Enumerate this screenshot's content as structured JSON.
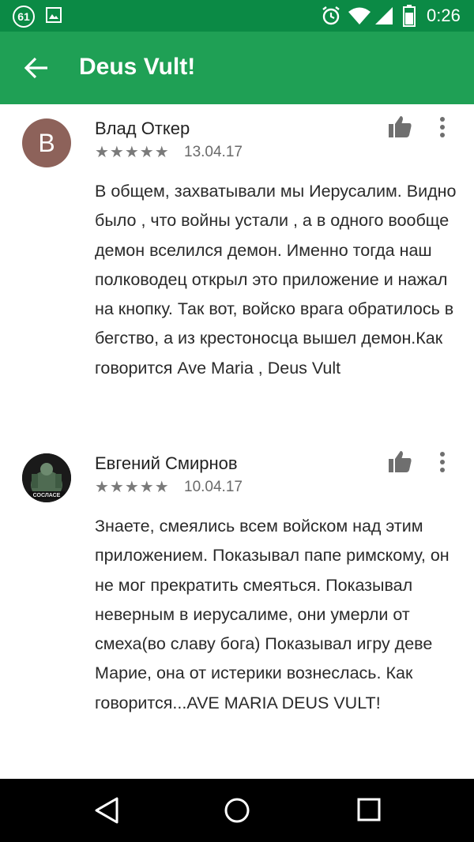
{
  "status_bar": {
    "notification_count": "61",
    "time": "0:26",
    "icons": [
      "image-icon",
      "alarm-icon",
      "wifi-icon",
      "signal-icon",
      "battery-icon"
    ]
  },
  "app_bar": {
    "title": "Deus Vult!",
    "background": "#1fa055",
    "status_background": "#0b8a45"
  },
  "reviews": [
    {
      "avatar_letter": "B",
      "author": "Влад Откер",
      "stars": "★★★★★",
      "rating": 5,
      "date": "13.04.17",
      "text": "В общем, захватывали мы Иерусалим. Видно было , что войны устали , а в одного вообще демон вселился демон. Именно тогда наш полководец открыл это приложение и нажал на кнопку. Так вот, войско врага обратилось в бегство, а из крестоносца вышел демон.Как говорится Ave Maria , Deus Vult"
    },
    {
      "avatar_caption": "СОСЛАСЕ",
      "author": "Евгений Смирнов",
      "stars": "★★★★★",
      "rating": 5,
      "date": "10.04.17",
      "text": "Знаете, смеялись всем войском над этим приложением. Показывал папе римскому, он не мог прекратить смеяться. Показывал неверным в иерусалиме, они умерли от смеха(во славу бога) Показывал игру деве Марие, она от истерики вознеслась. Как говорится...AVE MARIA DEUS VULT!"
    }
  ],
  "nav_bar": {
    "buttons": [
      "back-icon",
      "home-icon",
      "recents-icon"
    ]
  }
}
